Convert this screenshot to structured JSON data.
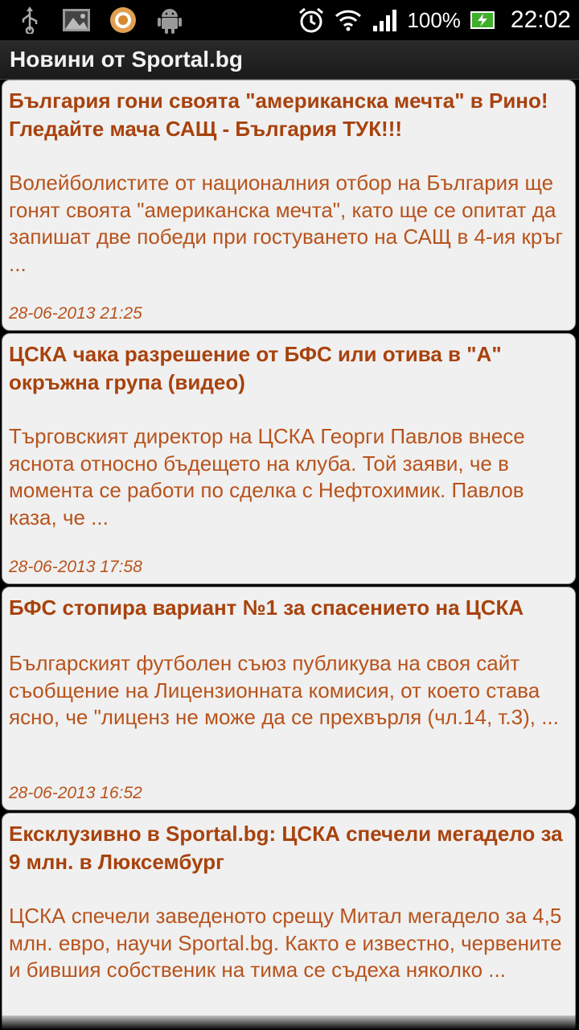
{
  "statusbar": {
    "left_icons": [
      "usb-icon",
      "image-icon",
      "app-icon",
      "android-icon"
    ],
    "battery_percent": "100%",
    "time": "22:02"
  },
  "titlebar": {
    "title": "Новини от Sportal.bg"
  },
  "articles": [
    {
      "headline": "България гони своята \"американска мечта\" в Рино! Гледайте мача САЩ - България ТУК!!!",
      "summary": "Волейболистите от националния отбор на България ще гонят своята \"американска мечта\", като ще се опитат да запишат две победи при гостуването на САЩ в 4-ия кръг ...",
      "timestamp": "28-06-2013 21:25"
    },
    {
      "headline": "ЦСКА чака разрешение от БФС или отива в \"А\" окръжна група (видео)",
      "summary": "Търговският директор на ЦСКА Георги Павлов внесе яснота относно бъдещето на клуба. Той заяви, че в момента се работи по сделка с Нефтохимик. Павлов каза, че ...",
      "timestamp": "28-06-2013 17:58"
    },
    {
      "headline": "БФС стопира вариант №1 за спасението на ЦСКА",
      "summary": "Българският футболен съюз публикува на своя сайт съобщение на Лицензионната комисия, от което става ясно, че \"лиценз не може да се прехвърля (чл.14, т.3), ...",
      "timestamp": "28-06-2013 16:52"
    },
    {
      "headline": "Ексклузивно в Sportal.bg: ЦСКА спечели мегадело за 9 млн. в Люксембург",
      "summary": "ЦСКА спечели заведеното срещу Митал мегадело за 4,5 млн. евро, научи Sportal.bg. Както е известно, червените и бившия собственик на тима се съдеха няколко ..."
    }
  ]
}
